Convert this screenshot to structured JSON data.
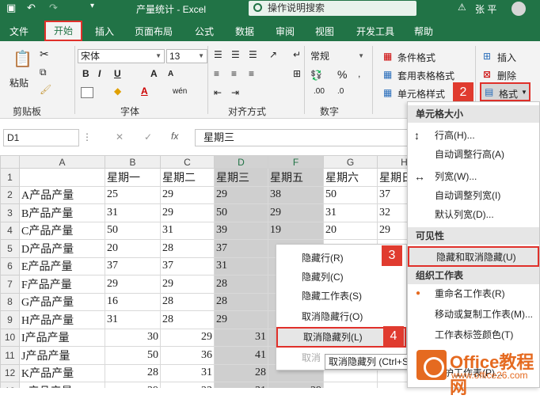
{
  "window": {
    "title": "产量统计 - Excel",
    "tell_me_placeholder": "操作说明搜索",
    "user": "张 平",
    "warning_icon": "warning-icon",
    "accent_color": "#217346",
    "highlight_color": "#e0302a"
  },
  "tabs": [
    "文件",
    "开始",
    "插入",
    "页面布局",
    "公式",
    "数据",
    "审阅",
    "视图",
    "开发工具",
    "帮助"
  ],
  "ribbon": {
    "clipboard": {
      "paste": "粘贴",
      "label": "剪贴板"
    },
    "font": {
      "name": "宋体",
      "size": "13",
      "bold": "B",
      "italic": "I",
      "underline": "U",
      "grow": "A",
      "shrink": "A",
      "font_color": "A",
      "wen": "wén",
      "label": "字体"
    },
    "alignment": {
      "label": "对齐方式"
    },
    "number": {
      "format": "常规",
      "percent": "%",
      "label": "数字"
    },
    "styles": {
      "conditional": "条件格式",
      "table": "套用表格格式",
      "cell": "单元格样式"
    },
    "cells": {
      "insert": "插入",
      "delete": "删除",
      "format": "格式"
    }
  },
  "badges": [
    "1",
    "2",
    "3",
    "4"
  ],
  "formula_bar": {
    "name_box": "D1",
    "cancel": "✕",
    "enter": "✓",
    "fx": "fx",
    "value": "星期三"
  },
  "sheet": {
    "col_headers": [
      "A",
      "B",
      "C",
      "D",
      "F",
      "G",
      "H"
    ],
    "header_row": [
      "",
      "星期一",
      "星期二",
      "星期三",
      "星期五",
      "星期六",
      "星期日"
    ],
    "rows": [
      {
        "n": "2",
        "cells": [
          "A产品产量",
          "25",
          "29",
          "29",
          "38",
          "50",
          "37"
        ]
      },
      {
        "n": "3",
        "cells": [
          "B产品产量",
          "31",
          "29",
          "50",
          "29",
          "31",
          "32"
        ]
      },
      {
        "n": "4",
        "cells": [
          "C产品产量",
          "50",
          "31",
          "39",
          "19",
          "20",
          "29"
        ]
      },
      {
        "n": "5",
        "cells": [
          "D产品产量",
          "20",
          "28",
          "37",
          "",
          "",
          ""
        ]
      },
      {
        "n": "6",
        "cells": [
          "E产品产量",
          "37",
          "37",
          "31",
          "",
          "",
          ""
        ]
      },
      {
        "n": "7",
        "cells": [
          "F产品产量",
          "29",
          "29",
          "28",
          "",
          "",
          ""
        ]
      },
      {
        "n": "8",
        "cells": [
          "G产品产量",
          "16",
          "28",
          "28",
          "",
          "",
          ""
        ]
      },
      {
        "n": "9",
        "cells": [
          "H产品产量",
          "31",
          "28",
          "29",
          "",
          "",
          ""
        ]
      },
      {
        "n": "10",
        "cells": [
          "I产品产量",
          "30",
          "29",
          "31",
          "",
          "",
          ""
        ]
      },
      {
        "n": "11",
        "cells": [
          "J产品产量",
          "50",
          "36",
          "41",
          "",
          "",
          ""
        ]
      },
      {
        "n": "12",
        "cells": [
          "K产品产量",
          "28",
          "31",
          "28",
          "",
          "",
          ""
        ]
      },
      {
        "n": "13",
        "cells": [
          "L产品产量",
          "29",
          "23",
          "31",
          "29",
          "",
          ""
        ]
      }
    ]
  },
  "context_menu": {
    "items": [
      "隐藏行(R)",
      "隐藏列(C)",
      "隐藏工作表(S)",
      "取消隐藏行(O)",
      "取消隐藏列(L)",
      "取消"
    ],
    "tooltip": "取消隐藏列 (Ctrl+S"
  },
  "format_menu": {
    "cell_size_header": "单元格大小",
    "row_height": "行高(H)...",
    "autofit_row": "自动调整行高(A)",
    "col_width": "列宽(W)...",
    "autofit_col": "自动调整列宽(I)",
    "default_width": "默认列宽(D)...",
    "visibility_header": "可见性",
    "hide_unhide": "隐藏和取消隐藏(U)",
    "organize_header": "组织工作表",
    "rename": "重命名工作表(R)",
    "move_copy": "移动或复制工作表(M)...",
    "tab_color": "工作表标签颜色(T)",
    "protect": "保护工作表(P)..."
  },
  "watermark": {
    "text": "Office教程网",
    "url": "www.office26.com"
  }
}
